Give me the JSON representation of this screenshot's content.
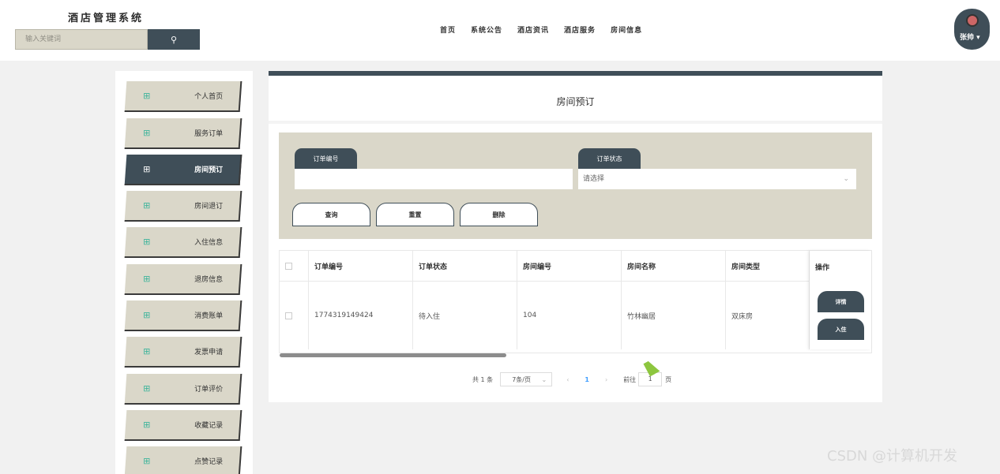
{
  "header": {
    "site_title": "酒店管理系统",
    "search_placeholder": "输入关键词",
    "nav": [
      "首页",
      "系统公告",
      "酒店资讯",
      "酒店服务",
      "房间信息"
    ],
    "user_name": "张帅"
  },
  "sidebar": {
    "items": [
      {
        "label": "个人首页",
        "active": false
      },
      {
        "label": "服务订单",
        "active": false
      },
      {
        "label": "房间预订",
        "active": true
      },
      {
        "label": "房间退订",
        "active": false
      },
      {
        "label": "入住信息",
        "active": false
      },
      {
        "label": "退房信息",
        "active": false
      },
      {
        "label": "消费账单",
        "active": false
      },
      {
        "label": "发票申请",
        "active": false
      },
      {
        "label": "订单评价",
        "active": false
      },
      {
        "label": "收藏记录",
        "active": false
      },
      {
        "label": "点赞记录",
        "active": false
      }
    ]
  },
  "main": {
    "title": "房间预订",
    "filter": {
      "order_no_label": "订单编号",
      "order_no_value": "",
      "status_label": "订单状态",
      "status_placeholder": "请选择",
      "query_button": "查询",
      "reset_button": "重置",
      "delete_button": "删除"
    },
    "table": {
      "columns": [
        "订单编号",
        "订单状态",
        "房间编号",
        "房间名称",
        "房间类型",
        "操作"
      ],
      "rows": [
        {
          "order_no": "1774319149424",
          "status": "待入住",
          "room_no": "104",
          "room_name": "竹林幽居",
          "room_type": "双床房"
        }
      ],
      "actions": {
        "detail": "详情",
        "checkin": "入住"
      }
    },
    "pagination": {
      "total": "共 1 条",
      "page_size": "7条/页",
      "current_page": "1",
      "goto_label": "前往",
      "goto_value": "1",
      "page_suffix": "页"
    }
  },
  "watermark": "CSDN @计算机开发"
}
